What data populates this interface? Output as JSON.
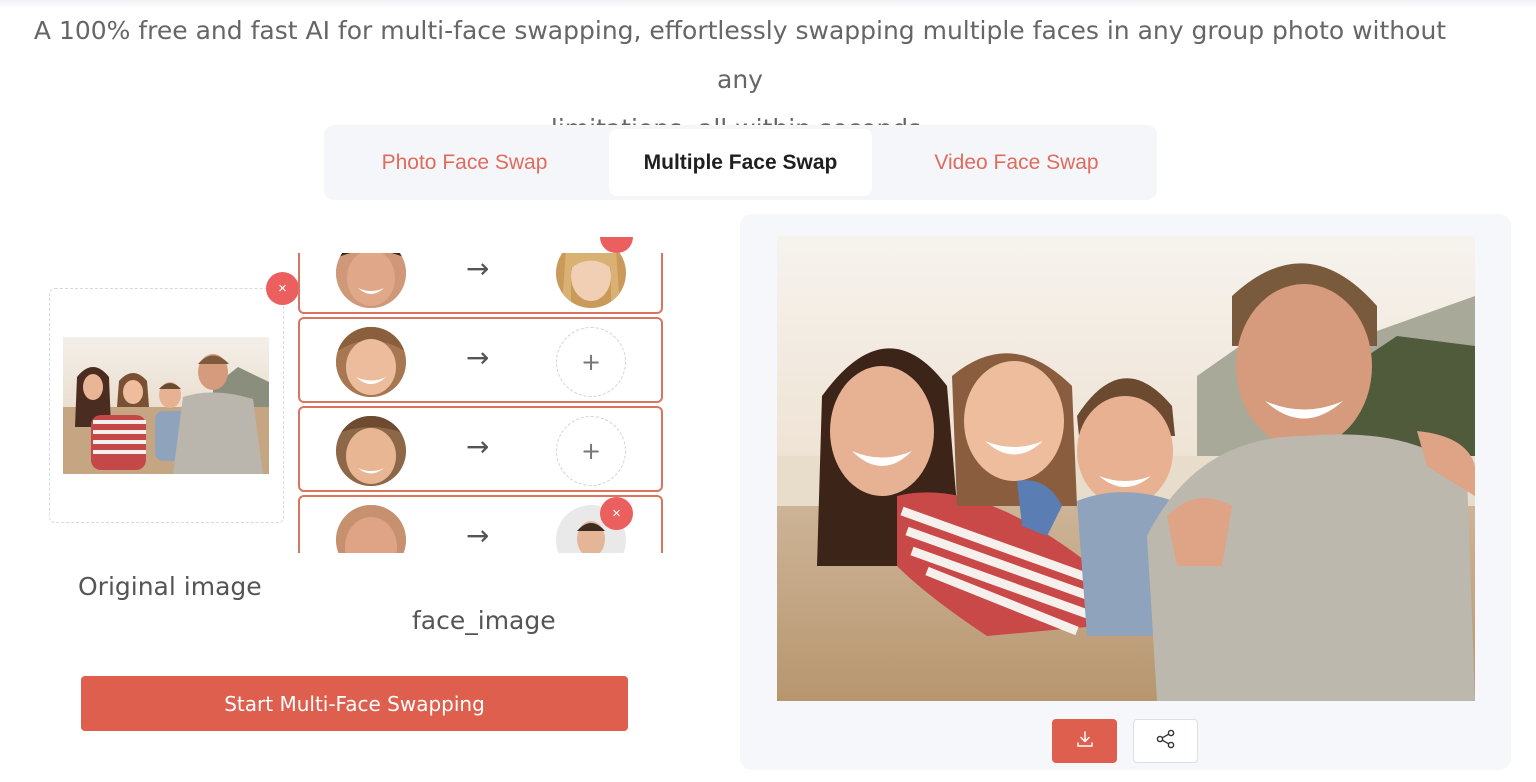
{
  "intro": {
    "line1": "A 100% free and fast AI for multi-face swapping, effortlessly swapping multiple faces in any group photo without any",
    "line2": "limitations, all within seconds."
  },
  "tabs": [
    {
      "label": "Photo Face Swap",
      "active": false
    },
    {
      "label": "Multiple Face Swap",
      "active": true
    },
    {
      "label": "Video Face Swap",
      "active": false
    }
  ],
  "upload": {
    "original_label": "Original image",
    "face_label": "face_image",
    "close_symbol": "×",
    "arrow_symbol": "→",
    "plus_symbol": "+"
  },
  "face_rows": [
    {
      "target": "face-image",
      "removable": true
    },
    {
      "target": "empty",
      "removable": false
    },
    {
      "target": "empty",
      "removable": false
    },
    {
      "target": "face-image",
      "removable": true
    }
  ],
  "actions": {
    "start_label": "Start Multi-Face Swapping",
    "download_icon": "download-icon",
    "share_icon": "share-icon"
  },
  "colors": {
    "accent": "#df5f4f",
    "tab_inactive": "#e06b5d",
    "badge": "#ec5f5f",
    "row_border": "#d9755f"
  }
}
